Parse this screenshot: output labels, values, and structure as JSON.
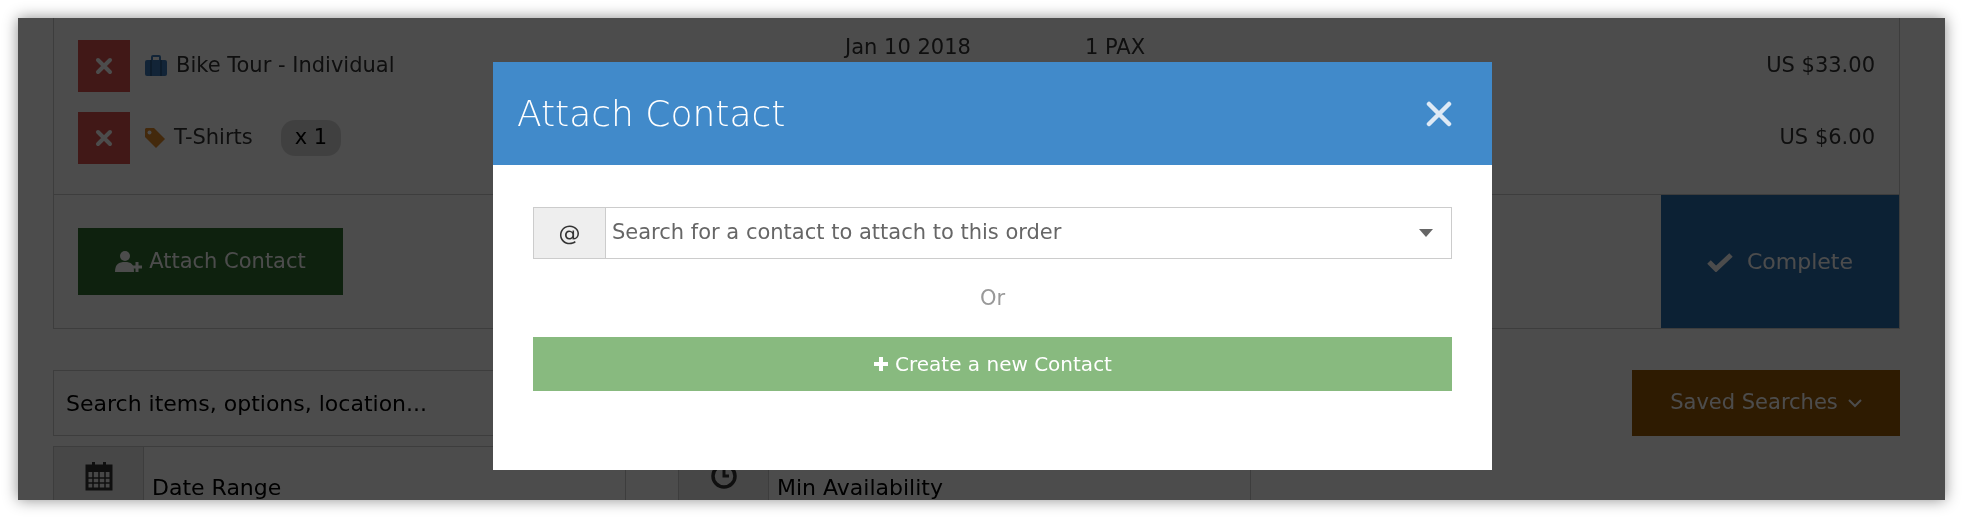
{
  "order_items": [
    {
      "kind": "tour",
      "name": "Bike Tour - Individual",
      "date": "Jan 10 2018",
      "quantity": "1 PAX",
      "price": "US $33.00"
    },
    {
      "kind": "product",
      "name": "T-Shirts",
      "count": "x 1",
      "price": "US $6.00"
    }
  ],
  "attach_button": "Attach Contact",
  "complete_button": "Complete",
  "filters": {
    "search_placeholder": "Search items, options, location...",
    "saved_searches": "Saved Searches",
    "date_placeholder": "Date Range",
    "availability_placeholder": "Min Availability"
  },
  "modal": {
    "title": "Attach Contact",
    "search_addon": "@",
    "search_placeholder": "Search for a contact to attach to this order",
    "separator": "Or",
    "create_button": "Create a new Contact"
  }
}
